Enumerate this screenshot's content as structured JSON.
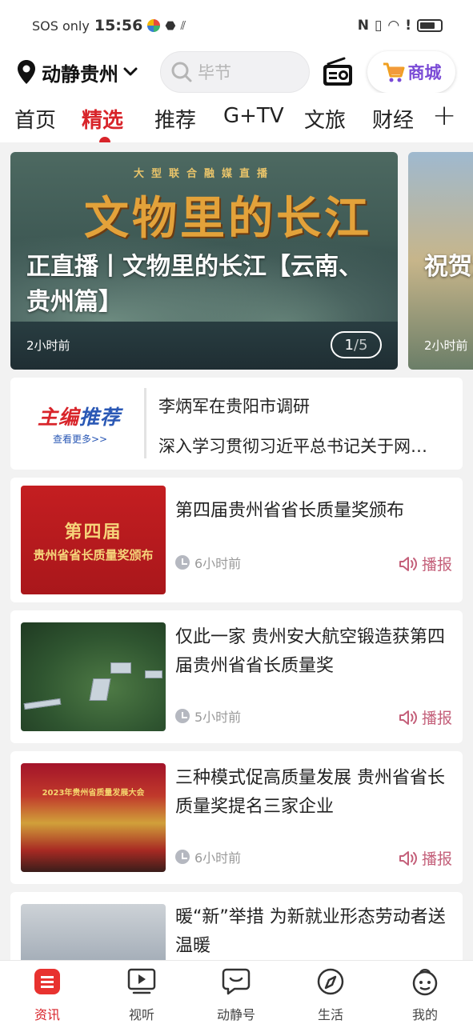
{
  "status_bar": {
    "carrier": "SOS only",
    "time": "15:56"
  },
  "header": {
    "location": "动静贵州",
    "search_placeholder": "毕节",
    "mall_label": "商城"
  },
  "tabs": [
    {
      "label": "首页",
      "active": false
    },
    {
      "label": "精选",
      "active": true
    },
    {
      "label": "推荐",
      "active": false
    },
    {
      "label": "G+TV",
      "active": false
    },
    {
      "label": "文旅",
      "active": false
    },
    {
      "label": "财经",
      "active": false
    }
  ],
  "banner": {
    "headline": "正直播丨文物里的长江【云南、贵州篇】",
    "subtitle": "大型联合融媒直播",
    "art_text": "文物里的长江",
    "time": "2小时前",
    "page_current": "1",
    "page_total": "/5",
    "next_headline": "祝贺洋水",
    "next_time": "2小时前"
  },
  "editor_picks": {
    "brand_1": "主编",
    "brand_2": "推荐",
    "more": "查看更多>>",
    "items": [
      "李炳军在贵阳市调研",
      "深入学习贯彻习近平总书记关于网…"
    ]
  },
  "news": [
    {
      "title": "第四届贵州省省长质量奖颁布",
      "time": "6小时前",
      "report": "播报",
      "thumb_big": "第四届",
      "thumb_small": "贵州省省长质量奖颁布"
    },
    {
      "title": "仅此一家 贵州安大航空锻造获第四届贵州省省长质量奖",
      "time": "5小时前",
      "report": "播报"
    },
    {
      "title": "三种模式促高质量发展 贵州省省长质量奖提名三家企业",
      "time": "6小时前",
      "report": "播报",
      "thumb_text": "2023年贵州省质量发展大会"
    },
    {
      "title": "暖“新”举措 为新就业形态劳动者送温暖"
    }
  ],
  "bottom_nav": [
    {
      "label": "资讯",
      "icon": "news-icon",
      "active": true
    },
    {
      "label": "视听",
      "icon": "video-icon",
      "active": false
    },
    {
      "label": "动静号",
      "icon": "chat-face-icon",
      "active": false
    },
    {
      "label": "生活",
      "icon": "compass-icon",
      "active": false
    },
    {
      "label": "我的",
      "icon": "mascot-icon",
      "active": false
    }
  ],
  "colors": {
    "accent": "#d8242a",
    "mall": "#7a4bd6",
    "report": "#c4607a"
  }
}
